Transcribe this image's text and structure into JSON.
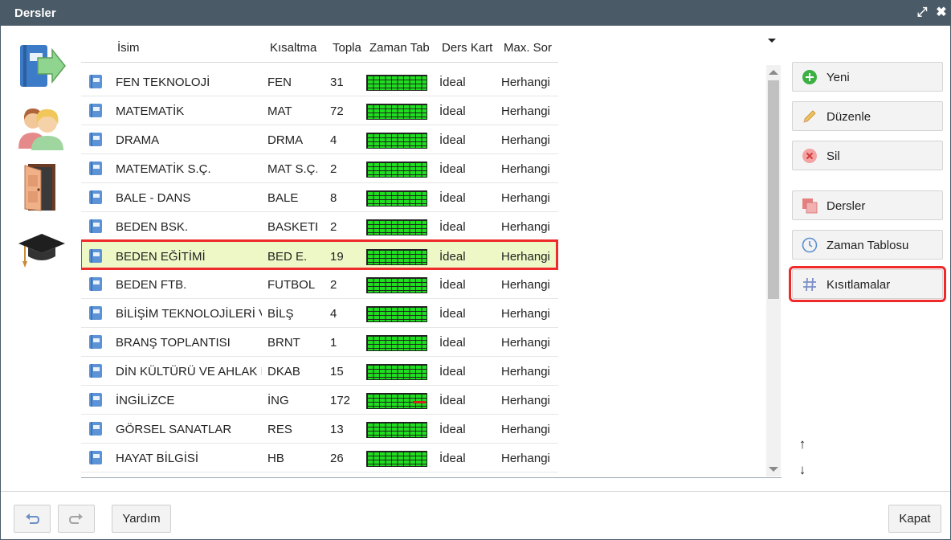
{
  "window": {
    "title": "Dersler"
  },
  "table": {
    "headers": [
      "İsim",
      "Kısaltma",
      "Topla",
      "Zaman Tab",
      "Ders Kart",
      "Max. Sor"
    ],
    "rows": [
      {
        "name": "FEN TEKNOLOJİ",
        "abbr": "FEN",
        "total": "31",
        "card": "İdeal",
        "max": "Herhangi"
      },
      {
        "name": "MATEMATİK",
        "abbr": "MAT",
        "total": "72",
        "card": "İdeal",
        "max": "Herhangi"
      },
      {
        "name": "DRAMA",
        "abbr": "DRMA",
        "total": "4",
        "card": "İdeal",
        "max": "Herhangi"
      },
      {
        "name": "MATEMATİK S.Ç.",
        "abbr": "MAT S.Ç.",
        "total": "2",
        "card": "İdeal",
        "max": "Herhangi"
      },
      {
        "name": "BALE - DANS",
        "abbr": "BALE",
        "total": "8",
        "card": "İdeal",
        "max": "Herhangi"
      },
      {
        "name": "BEDEN BSK.",
        "abbr": "BASKETB",
        "total": "2",
        "card": "İdeal",
        "max": "Herhangi"
      },
      {
        "name": "BEDEN EĞİTİMİ",
        "abbr": "BED E.",
        "total": "19",
        "card": "İdeal",
        "max": "Herhangi"
      },
      {
        "name": "BEDEN FTB.",
        "abbr": "FUTBOL",
        "total": "2",
        "card": "İdeal",
        "max": "Herhangi"
      },
      {
        "name": "BİLİŞİM TEKNOLOJİLERİ V",
        "abbr": "BİLŞ",
        "total": "4",
        "card": "İdeal",
        "max": "Herhangi"
      },
      {
        "name": "BRANŞ TOPLANTISI",
        "abbr": "BRNT",
        "total": "1",
        "card": "İdeal",
        "max": "Herhangi"
      },
      {
        "name": "DİN KÜLTÜRÜ VE AHLAK B",
        "abbr": "DKAB",
        "total": "15",
        "card": "İdeal",
        "max": "Herhangi"
      },
      {
        "name": "İNGİLİZCE",
        "abbr": "İNG",
        "total": "172",
        "card": "İdeal",
        "max": "Herhangi"
      },
      {
        "name": "GÖRSEL SANATLAR",
        "abbr": "RES",
        "total": "13",
        "card": "İdeal",
        "max": "Herhangi"
      },
      {
        "name": "HAYAT BİLGİSİ",
        "abbr": "HB",
        "total": "26",
        "card": "İdeal",
        "max": "Herhangi"
      }
    ],
    "selected_row": "BEDEN EĞİTİMİ"
  },
  "actions": {
    "new": "Yeni",
    "edit": "Düzenle",
    "delete": "Sil",
    "lessons": "Dersler",
    "timetable": "Zaman Tablosu",
    "constraints": "Kısıtlamalar"
  },
  "footer": {
    "help": "Yardım",
    "close": "Kapat"
  },
  "icons": {
    "titlebar": [
      "maximize-icon",
      "close-icon"
    ],
    "side": [
      "lesson-arrow-icon",
      "teachers-icon",
      "classroom-door-icon",
      "graduation-cap-icon"
    ],
    "row": "book-icon",
    "move": [
      "arrow-up-icon",
      "arrow-down-icon"
    ]
  },
  "colors": {
    "titlebar": "#4a5b67",
    "selected_row": "#eef8c6",
    "highlight": "#ee2a2a",
    "timetable_green": "#1ee01e"
  }
}
